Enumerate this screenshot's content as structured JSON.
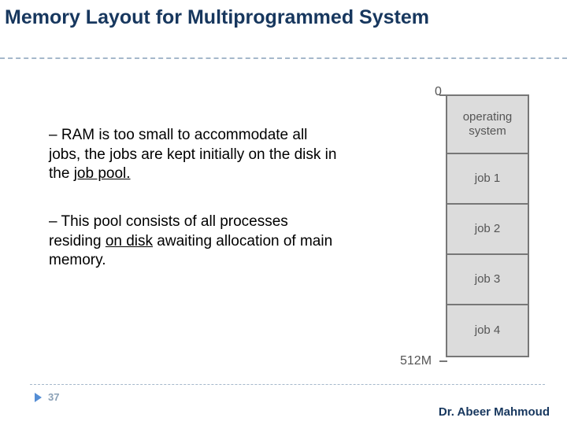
{
  "title": "Memory Layout for Multiprogrammed System",
  "bullets": {
    "p1_prefix": "– RAM is too small to accommodate all jobs, the jobs are kept initially on the disk in the ",
    "p1_underlined": "job pool.",
    "p2_prefix": "– This pool consists of all processes residing ",
    "p2_underlined": "on disk",
    "p2_suffix": " awaiting allocation of main memory."
  },
  "diagram": {
    "top_label": "0",
    "bottom_label": "512M",
    "cells": {
      "os": "operating system",
      "job1": "job 1",
      "job2": "job 2",
      "job3": "job 3",
      "job4": "job 4"
    }
  },
  "page_number": "37",
  "footer": "Dr. Abeer Mahmoud"
}
